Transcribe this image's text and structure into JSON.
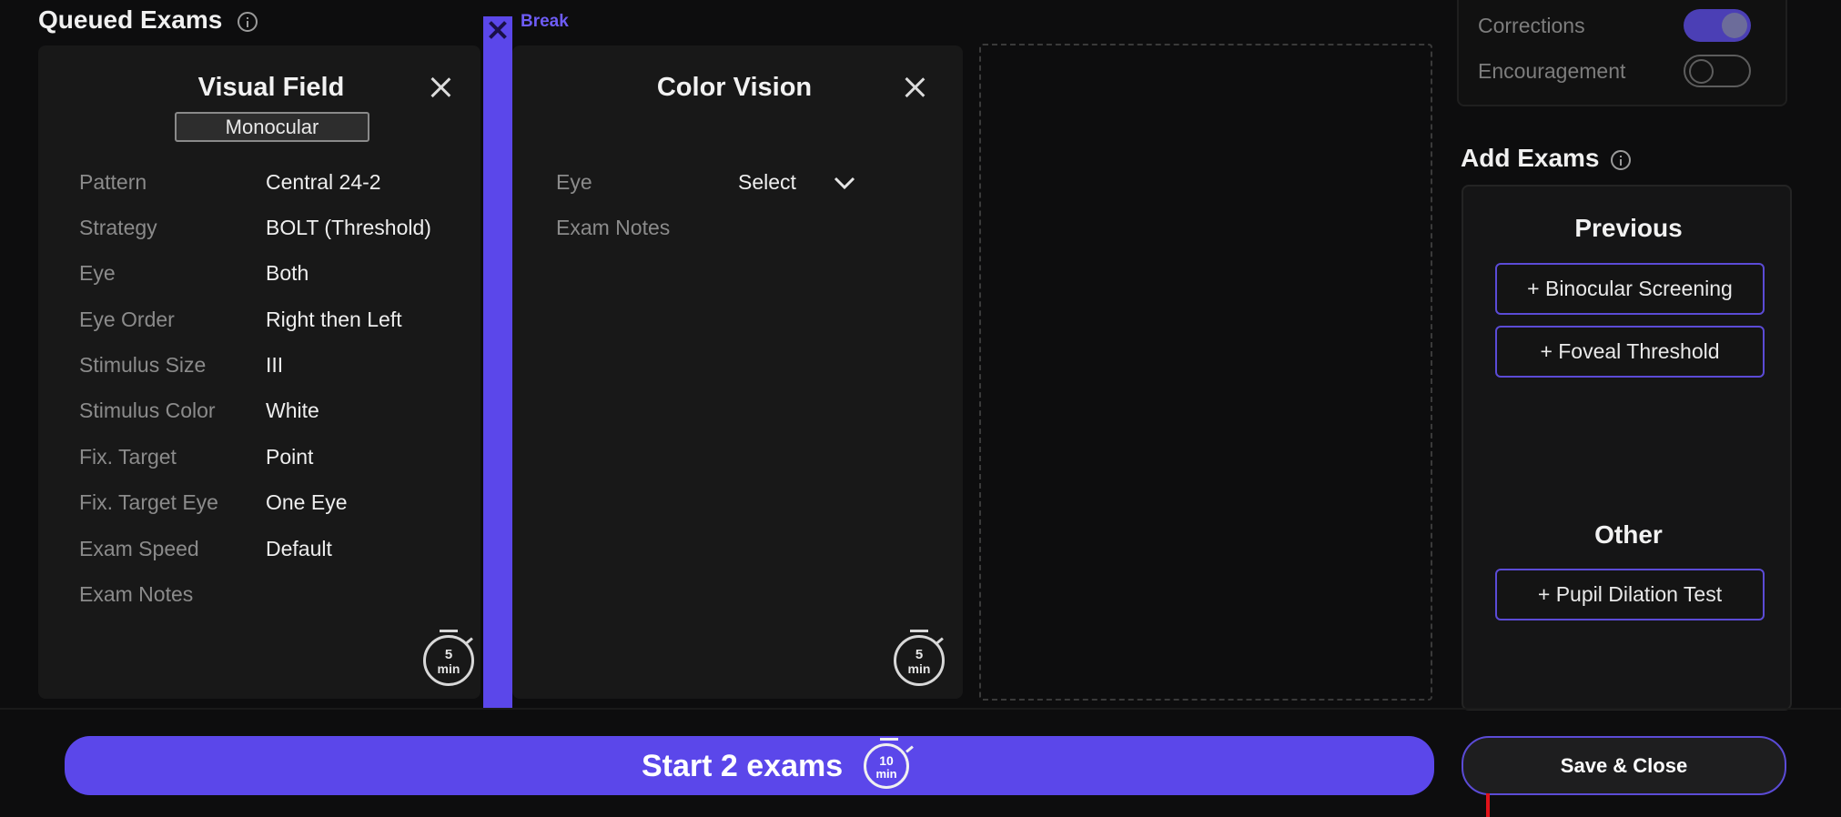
{
  "queued": {
    "title": "Queued Exams",
    "cards": [
      {
        "title": "Visual Field",
        "badge": "Monocular",
        "rows": [
          {
            "label": "Pattern",
            "value": "Central 24-2"
          },
          {
            "label": "Strategy",
            "value": "BOLT (Threshold)"
          },
          {
            "label": "Eye",
            "value": "Both"
          },
          {
            "label": "Eye Order",
            "value": "Right then Left"
          },
          {
            "label": "Stimulus Size",
            "value": "III"
          },
          {
            "label": "Stimulus Color",
            "value": "White"
          },
          {
            "label": "Fix. Target",
            "value": "Point"
          },
          {
            "label": "Fix. Target Eye",
            "value": "One Eye"
          },
          {
            "label": "Exam Speed",
            "value": "Default"
          },
          {
            "label": "Exam Notes",
            "value": ""
          }
        ],
        "timer_value": "5",
        "timer_unit": "min"
      },
      {
        "title": "Color Vision",
        "rows": [
          {
            "label": "Eye",
            "value": "Select"
          },
          {
            "label": "Exam Notes",
            "value": ""
          }
        ],
        "timer_value": "5",
        "timer_unit": "min"
      }
    ],
    "break_label": "Break"
  },
  "settings": {
    "toggles": [
      {
        "label": "Corrections",
        "on": true
      },
      {
        "label": "Encouragement",
        "on": false
      }
    ]
  },
  "add_exams": {
    "title": "Add Exams",
    "previous_heading": "Previous",
    "previous": [
      "+ Binocular Screening",
      "+ Foveal Threshold"
    ],
    "other_heading": "Other",
    "other": [
      "+ Pupil Dilation Test"
    ]
  },
  "footer": {
    "start_label": "Start 2 exams",
    "start_timer_value": "10",
    "start_timer_unit": "min",
    "save_label": "Save & Close"
  },
  "colors": {
    "accent": "#5b47ea",
    "background": "#0d0d0e",
    "card": "#181818"
  }
}
